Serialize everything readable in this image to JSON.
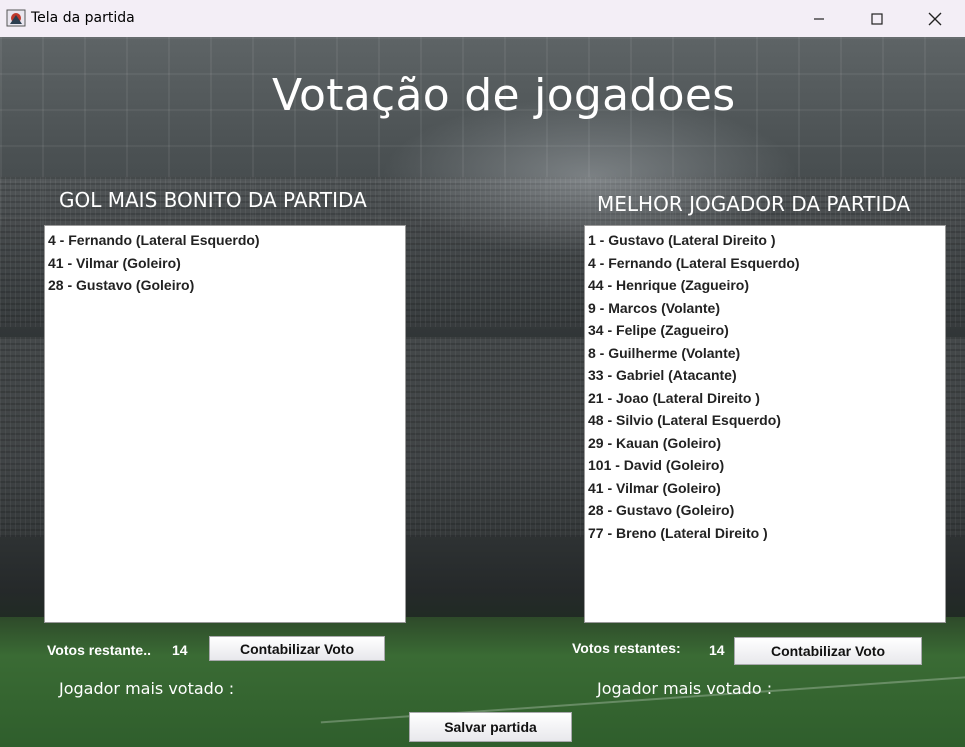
{
  "window": {
    "title": "Tela da partida",
    "controls": [
      "minimize-icon",
      "maximize-icon",
      "close-icon"
    ]
  },
  "heading": "Votação de jogadoes",
  "left_panel": {
    "title": "GOL MAIS BONITO DA PARTIDA",
    "items": [
      "4 - Fernando (Lateral Esquerdo)",
      "41 - Vilmar (Goleiro)",
      "28 - Gustavo (Goleiro)"
    ],
    "votes_label": "Votos restante..",
    "votes_count": "14",
    "button_label": "Contabilizar Voto",
    "most_voted_label": "Jogador mais votado :"
  },
  "right_panel": {
    "title": "MELHOR JOGADOR DA PARTIDA",
    "items": [
      "1 - Gustavo (Lateral Direito )",
      "4 - Fernando (Lateral Esquerdo)",
      "44 - Henrique (Zagueiro)",
      "9 - Marcos (Volante)",
      "34 - Felipe (Zagueiro)",
      "8 - Guilherme (Volante)",
      "33 - Gabriel (Atacante)",
      "21 - Joao (Lateral Direito )",
      "48 - Silvio (Lateral Esquerdo)",
      "29 - Kauan (Goleiro)",
      "101 - David (Goleiro)",
      "41 - Vilmar (Goleiro)",
      "28 - Gustavo (Goleiro)",
      "77 - Breno (Lateral Direito )"
    ],
    "votes_label": "Votos restantes:",
    "votes_count": "14",
    "button_label": "Contabilizar Voto",
    "most_voted_label": "Jogador mais votado :"
  },
  "save_button_label": "Salvar partida"
}
